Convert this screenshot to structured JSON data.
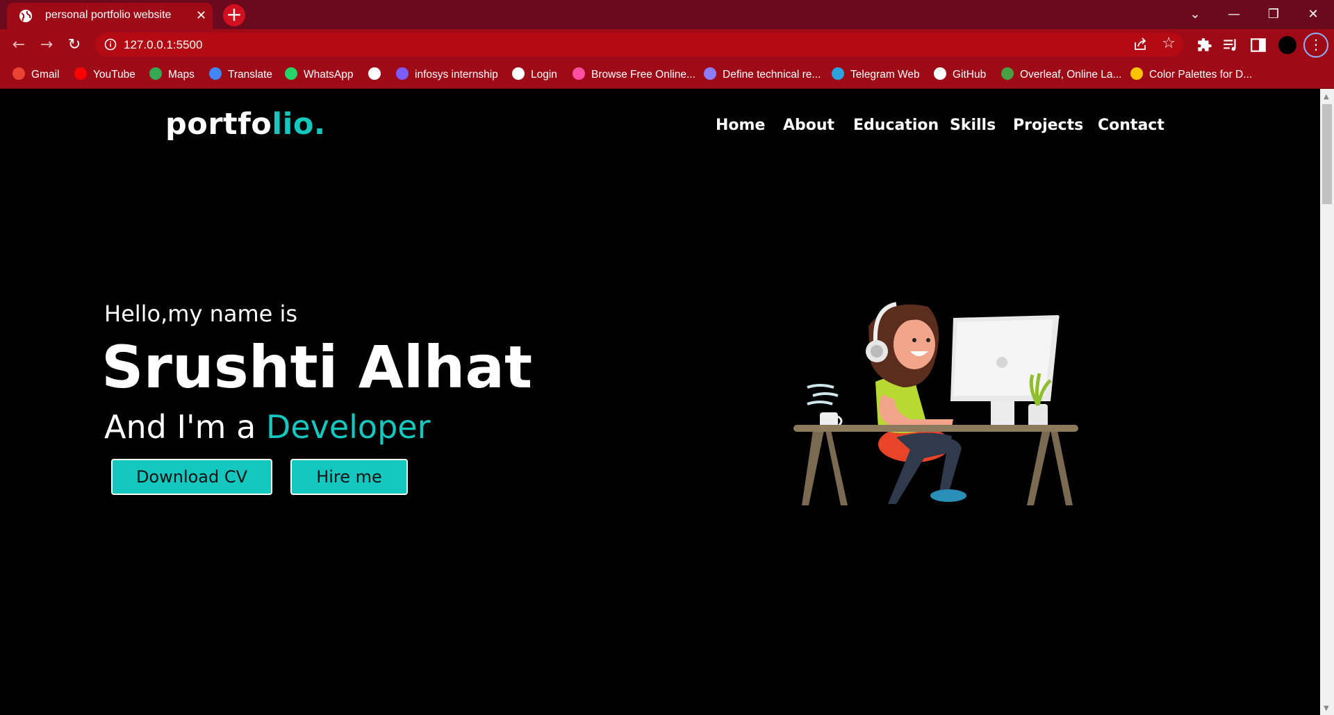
{
  "browser": {
    "tab_title": "personal portfolio website",
    "tab_close": "✕",
    "new_tab": "+",
    "url": "127.0.0.1:5500",
    "window_controls": {
      "list": "⌄",
      "minimize": "—",
      "restore": "❐",
      "close": "✕"
    },
    "menu": "⋮",
    "bookmarks": [
      {
        "label": "Gmail",
        "color": "#ea4335"
      },
      {
        "label": "YouTube",
        "color": "#ff0000"
      },
      {
        "label": "Maps",
        "color": "#34a853"
      },
      {
        "label": "Translate",
        "color": "#4285f4"
      },
      {
        "label": "WhatsApp",
        "color": "#25d366"
      },
      {
        "label": "",
        "color": "#ffffff"
      },
      {
        "label": "infosys internship",
        "color": "#7b5cff"
      },
      {
        "label": "Login",
        "color": "#ffffff"
      },
      {
        "label": "Browse Free Online...",
        "color": "#ff4fa3"
      },
      {
        "label": "Define technical re...",
        "color": "#8e7cff"
      },
      {
        "label": "Telegram Web",
        "color": "#2aa3e0"
      },
      {
        "label": "GitHub",
        "color": "#ffffff"
      },
      {
        "label": "Overleaf, Online La...",
        "color": "#47a141"
      },
      {
        "label": "Color Palettes for D...",
        "color": "#ffc400"
      }
    ]
  },
  "site": {
    "logo_main": "portfo",
    "logo_accent": "lio.",
    "nav": [
      "Home",
      "About",
      "Education",
      "Skills",
      "Projects",
      "Contact"
    ],
    "hero": {
      "greeting": "Hello,my name is",
      "name": "Srushti Alhat",
      "role_prefix": "And I'm a ",
      "role": "Developer",
      "buttons": [
        "Download CV",
        "Hire me"
      ]
    },
    "accent_color": "#14c8c0"
  }
}
